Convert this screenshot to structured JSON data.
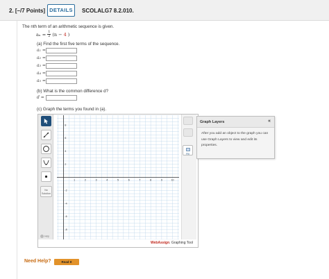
{
  "header": {
    "question_number": "2.  [–/7 Points]",
    "details_label": "DETAILS",
    "question_code": "SCOLALG7 8.2.010."
  },
  "prompt": {
    "intro": "The nth term of an arithmetic sequence is given.",
    "formula_lhs": "aₙ =",
    "frac_num": "1",
    "frac_den": "2",
    "formula_open": "(n −",
    "formula_const": "4",
    "formula_close": ")"
  },
  "part_a": {
    "question": "(a) Find the first five terms of the sequence.",
    "terms": [
      {
        "label": "a₁ =",
        "value": ""
      },
      {
        "label": "a₂ =",
        "value": ""
      },
      {
        "label": "a₃ =",
        "value": ""
      },
      {
        "label": "a₄ =",
        "value": ""
      },
      {
        "label": "a₅ =",
        "value": ""
      }
    ]
  },
  "part_b": {
    "question": "(b) What is the common difference d?",
    "label": "d =",
    "value": ""
  },
  "part_c": {
    "question": "(c) Graph the terms you found in (a)."
  },
  "graph": {
    "x_ticks": [
      "1",
      "2",
      "3",
      "4",
      "5",
      "6",
      "7",
      "8",
      "9",
      "10"
    ],
    "y_ticks": [
      "8",
      "6",
      "4",
      "2",
      "-2",
      "-4",
      "-6",
      "-8"
    ],
    "tools": [
      "pointer-tool",
      "line-tool",
      "circle-tool",
      "parabola-tool",
      "point-tool"
    ],
    "no_solution_label": "No Solution",
    "help_label": "Help",
    "fill_label": "Fill",
    "footer_brand_web": "Web",
    "footer_brand_assign": "Assign",
    "footer_suffix": ". Graphing Tool"
  },
  "layers_panel": {
    "title": "Graph Layers",
    "collapse": "«",
    "body": "After you add an object to the graph you can use Graph Layers to view and edit its properties."
  },
  "help": {
    "need_help": "Need Help?",
    "read_it": "Read It"
  },
  "colors": {
    "accent_blue": "#2c6e9e",
    "highlight_red": "#c0281d",
    "help_orange": "#c76a10",
    "read_button": "#e2922a",
    "tool_active": "#1f4e7a"
  }
}
